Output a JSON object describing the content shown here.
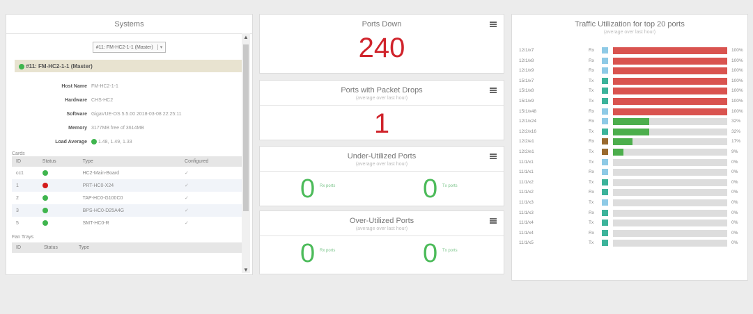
{
  "systems": {
    "title": "Systems",
    "selector_value": "#11: FM-HC2-1-1 (Master)",
    "banner": "#11: FM-HC2-1-1 (Master)",
    "details": [
      {
        "key": "Host Name",
        "value": "FM-HC2-1-1"
      },
      {
        "key": "Hardware",
        "value": "CHS-HC2"
      },
      {
        "key": "Software",
        "value": "GigaVUE-OS 5.5.00 2018-03-08 22:25:11"
      },
      {
        "key": "Memory",
        "value": "3177MB free of 3614MB"
      },
      {
        "key": "Load Average",
        "value": "1.48, 1.49, 1.33"
      }
    ],
    "cards_label": "Cards",
    "cards_headers": [
      "ID",
      "Status",
      "Type",
      "Configured"
    ],
    "cards": [
      {
        "id": "cc1",
        "status": "green",
        "type": "HC2-Main-Board",
        "configured": "✓"
      },
      {
        "id": "1",
        "status": "red",
        "type": "PRT-HC0-X24",
        "configured": "✓"
      },
      {
        "id": "2",
        "status": "green",
        "type": "TAP-HC0-G100C0",
        "configured": "✓"
      },
      {
        "id": "3",
        "status": "green",
        "type": "BPS-HC0-D25A4G",
        "configured": "✓"
      },
      {
        "id": "5",
        "status": "green",
        "type": "SMT-HC0-R",
        "configured": "✓"
      }
    ],
    "fan_label": "Fan Trays",
    "fan_headers": [
      "ID",
      "Status",
      "Type"
    ]
  },
  "ports_down": {
    "title": "Ports Down",
    "value": "240"
  },
  "packet_drops": {
    "title": "Ports with Packet Drops",
    "subtitle": "(average over last hour)",
    "value": "1"
  },
  "under_util": {
    "title": "Under-Utilized Ports",
    "subtitle": "(average over last hour)",
    "rx_value": "0",
    "rx_label": "Rx ports",
    "tx_value": "0",
    "tx_label": "Tx ports"
  },
  "over_util": {
    "title": "Over-Utilized Ports",
    "subtitle": "(average over last hour)",
    "rx_value": "0",
    "rx_label": "Rx ports",
    "tx_value": "0",
    "tx_label": "Tx ports"
  },
  "traffic": {
    "title": "Traffic Utilization for top 20 ports",
    "subtitle": "(average over last hour)",
    "colors": {
      "red": "#d9534f",
      "green": "#4cae4c",
      "blue": "#8ecae6",
      "teal": "#3cb39a",
      "brown": "#9a6a2e"
    },
    "rows": [
      {
        "port": "12/1/x7",
        "dir": "Rx",
        "badge": "blue",
        "pct": 100,
        "label": "100%"
      },
      {
        "port": "12/1/x8",
        "dir": "Rx",
        "badge": "blue",
        "pct": 100,
        "label": "100%"
      },
      {
        "port": "12/1/x9",
        "dir": "Rx",
        "badge": "blue",
        "pct": 100,
        "label": "100%"
      },
      {
        "port": "15/1/x7",
        "dir": "Tx",
        "badge": "teal",
        "pct": 100,
        "label": "100%"
      },
      {
        "port": "15/1/x8",
        "dir": "Tx",
        "badge": "teal",
        "pct": 100,
        "label": "100%"
      },
      {
        "port": "15/1/x9",
        "dir": "Tx",
        "badge": "teal",
        "pct": 100,
        "label": "100%"
      },
      {
        "port": "15/1/x48",
        "dir": "Rx",
        "badge": "blue",
        "pct": 100,
        "label": "100%"
      },
      {
        "port": "12/1/x24",
        "dir": "Rx",
        "badge": "blue",
        "pct": 32,
        "label": "32%"
      },
      {
        "port": "12/2/x16",
        "dir": "Tx",
        "badge": "teal",
        "pct": 32,
        "label": "32%"
      },
      {
        "port": "12/2/e1",
        "dir": "Rx",
        "badge": "brown",
        "pct": 17,
        "label": "17%"
      },
      {
        "port": "12/2/e1",
        "dir": "Tx",
        "badge": "brown",
        "pct": 9,
        "label": "9%"
      },
      {
        "port": "11/1/x1",
        "dir": "Tx",
        "badge": "blue",
        "pct": 0,
        "label": "0%"
      },
      {
        "port": "11/1/x1",
        "dir": "Rx",
        "badge": "blue",
        "pct": 0,
        "label": "0%"
      },
      {
        "port": "11/1/x2",
        "dir": "Tx",
        "badge": "teal",
        "pct": 0,
        "label": "0%"
      },
      {
        "port": "11/1/x2",
        "dir": "Rx",
        "badge": "teal",
        "pct": 0,
        "label": "0%"
      },
      {
        "port": "11/1/x3",
        "dir": "Tx",
        "badge": "blue",
        "pct": 0,
        "label": "0%"
      },
      {
        "port": "11/1/x3",
        "dir": "Rx",
        "badge": "teal",
        "pct": 0,
        "label": "0%"
      },
      {
        "port": "11/1/x4",
        "dir": "Tx",
        "badge": "teal",
        "pct": 0,
        "label": "0%"
      },
      {
        "port": "11/1/x4",
        "dir": "Rx",
        "badge": "teal",
        "pct": 0,
        "label": "0%"
      },
      {
        "port": "11/1/x5",
        "dir": "Tx",
        "badge": "teal",
        "pct": 0,
        "label": "0%"
      }
    ]
  }
}
